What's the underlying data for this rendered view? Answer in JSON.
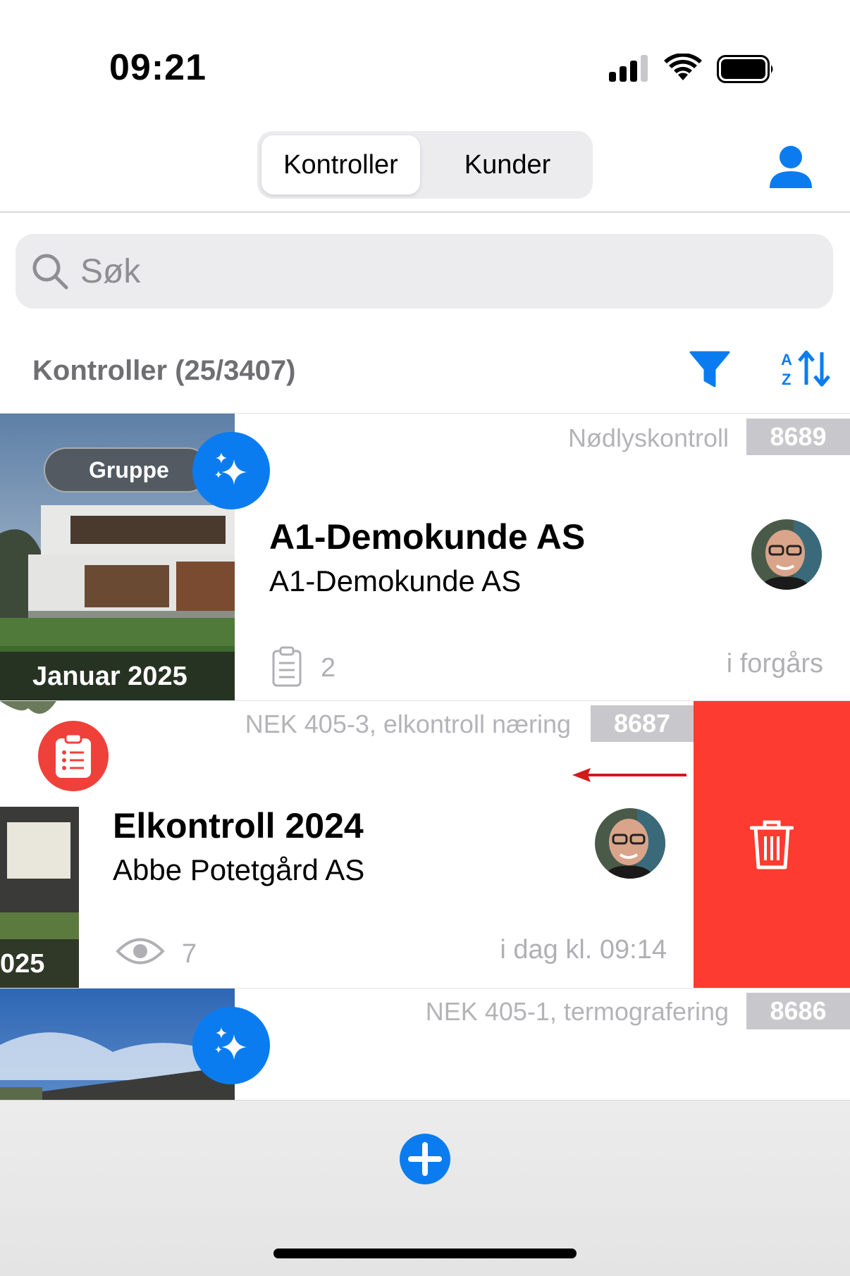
{
  "status_bar": {
    "time": "09:21",
    "icons": [
      "signal-icon",
      "wifi-icon",
      "battery-icon"
    ]
  },
  "header": {
    "tabs": [
      {
        "label": "Kontroller",
        "active": true
      },
      {
        "label": "Kunder",
        "active": false
      }
    ],
    "profile_icon": "person-icon"
  },
  "search": {
    "placeholder": "Søk",
    "value": ""
  },
  "list": {
    "title": "Kontroller (25/3407)",
    "filter_icon": "filter-icon",
    "sort_icon": "sort-az-icon"
  },
  "cards": [
    {
      "type": "Nødlyskontroll",
      "id": "8689",
      "title": "A1-Demokunde AS",
      "subtitle": "A1-Demokunde AS",
      "pill": "Gruppe",
      "date_overlay": "Januar 2025",
      "count": "2",
      "count_icon": "clipboard-icon",
      "time": "i forgårs",
      "badge_icon": "sparkles-icon"
    },
    {
      "type": "NEK 405-3, elkontroll næring",
      "id": "8687",
      "title": "Elkontroll 2024",
      "subtitle": "Abbe Potetgård AS",
      "date_overlay": "025",
      "count": "7",
      "count_icon": "eye-icon",
      "time": "i dag kl. 09:14",
      "badge_icon": "clipboard-list-icon",
      "swipe_action": "trash-icon"
    },
    {
      "type": "NEK 405-1, termografering",
      "id": "8686",
      "badge_icon": "sparkles-icon"
    }
  ],
  "toolbar": {
    "add_icon": "plus-circle-icon"
  },
  "colors": {
    "accent": "#0a7cf0",
    "delete": "#fe3b30",
    "secondary_text": "#b4b4b8"
  }
}
